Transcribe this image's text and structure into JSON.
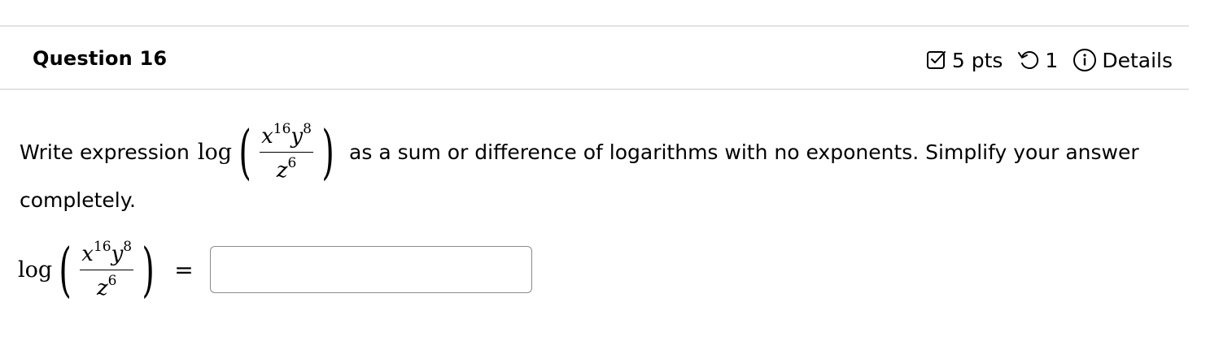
{
  "question": {
    "title": "Question 16",
    "points": "5 pts",
    "attempts": "1",
    "details_label": "Details"
  },
  "prompt": {
    "prefix": "Write expression",
    "log": "log",
    "numerator_x": "x",
    "numerator_x_exp": "16",
    "numerator_y": "y",
    "numerator_y_exp": "8",
    "denominator_z": "z",
    "denominator_z_exp": "6",
    "suffix": "as a sum or difference of logarithms with no exponents. Simplify your answer",
    "line2": "completely."
  },
  "answer": {
    "equals": "=",
    "value": "",
    "placeholder": ""
  },
  "icons": {
    "points": "checkbox-icon",
    "attempts": "retry-icon",
    "details": "info-icon"
  }
}
